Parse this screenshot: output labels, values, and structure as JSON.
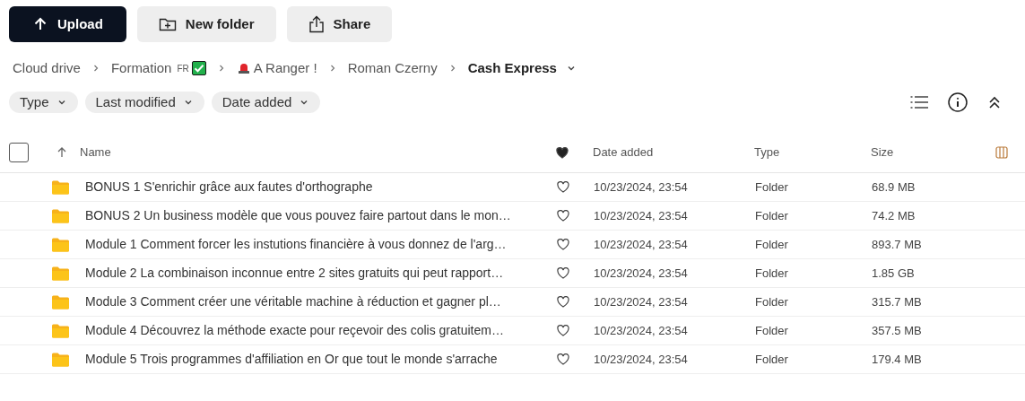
{
  "toolbar": [
    {
      "kind": "upload",
      "label": "Upload"
    },
    {
      "kind": "new-folder",
      "label": "New folder"
    },
    {
      "kind": "share",
      "label": "Share"
    }
  ],
  "breadcrumb": [
    {
      "kind": "plain",
      "label": "Cloud drive",
      "current": false
    },
    {
      "kind": "checked",
      "label": "Formation",
      "tag": "FR",
      "current": false
    },
    {
      "kind": "alert",
      "label": "A Ranger !",
      "current": false
    },
    {
      "kind": "plain",
      "label": "Roman Czerny",
      "current": false
    },
    {
      "kind": "plain",
      "label": "Cash Express",
      "current": true
    }
  ],
  "filters": [
    "Type",
    "Last modified",
    "Date added"
  ],
  "table": {
    "columns": [
      "Name",
      "Date added",
      "Type",
      "Size"
    ],
    "sort_ascending": true,
    "select_all": {
      "checked": false
    },
    "rows": [
      {
        "name": "BONUS 1 S'enrichir grâce aux fautes d'orthographe",
        "favorite": false,
        "date_added": "10/23/2024, 23:54",
        "type": "Folder",
        "size": "68.9 MB"
      },
      {
        "name": "BONUS 2 Un business modèle que vous pouvez faire partout dans le mon…",
        "favorite": false,
        "date_added": "10/23/2024, 23:54",
        "type": "Folder",
        "size": "74.2 MB"
      },
      {
        "name": "Module 1 Comment forcer les instutions financière à vous donnez de l'arg…",
        "favorite": false,
        "date_added": "10/23/2024, 23:54",
        "type": "Folder",
        "size": "893.7 MB"
      },
      {
        "name": "Module 2 La combinaison inconnue entre 2 sites gratuits qui peut rapport…",
        "favorite": false,
        "date_added": "10/23/2024, 23:54",
        "type": "Folder",
        "size": "1.85 GB"
      },
      {
        "name": "Module 3 Comment créer une véritable machine à réduction et gagner pl…",
        "favorite": false,
        "date_added": "10/23/2024, 23:54",
        "type": "Folder",
        "size": "315.7 MB"
      },
      {
        "name": "Module 4 Découvrez la méthode exacte pour reçevoir des colis gratuitem…",
        "favorite": false,
        "date_added": "10/23/2024, 23:54",
        "type": "Folder",
        "size": "357.5 MB"
      },
      {
        "name": "Module 5 Trois programmes d'affiliation en Or que tout le monde s'arrache",
        "favorite": false,
        "date_added": "10/23/2024, 23:54",
        "type": "Folder",
        "size": "179.4 MB"
      }
    ]
  }
}
